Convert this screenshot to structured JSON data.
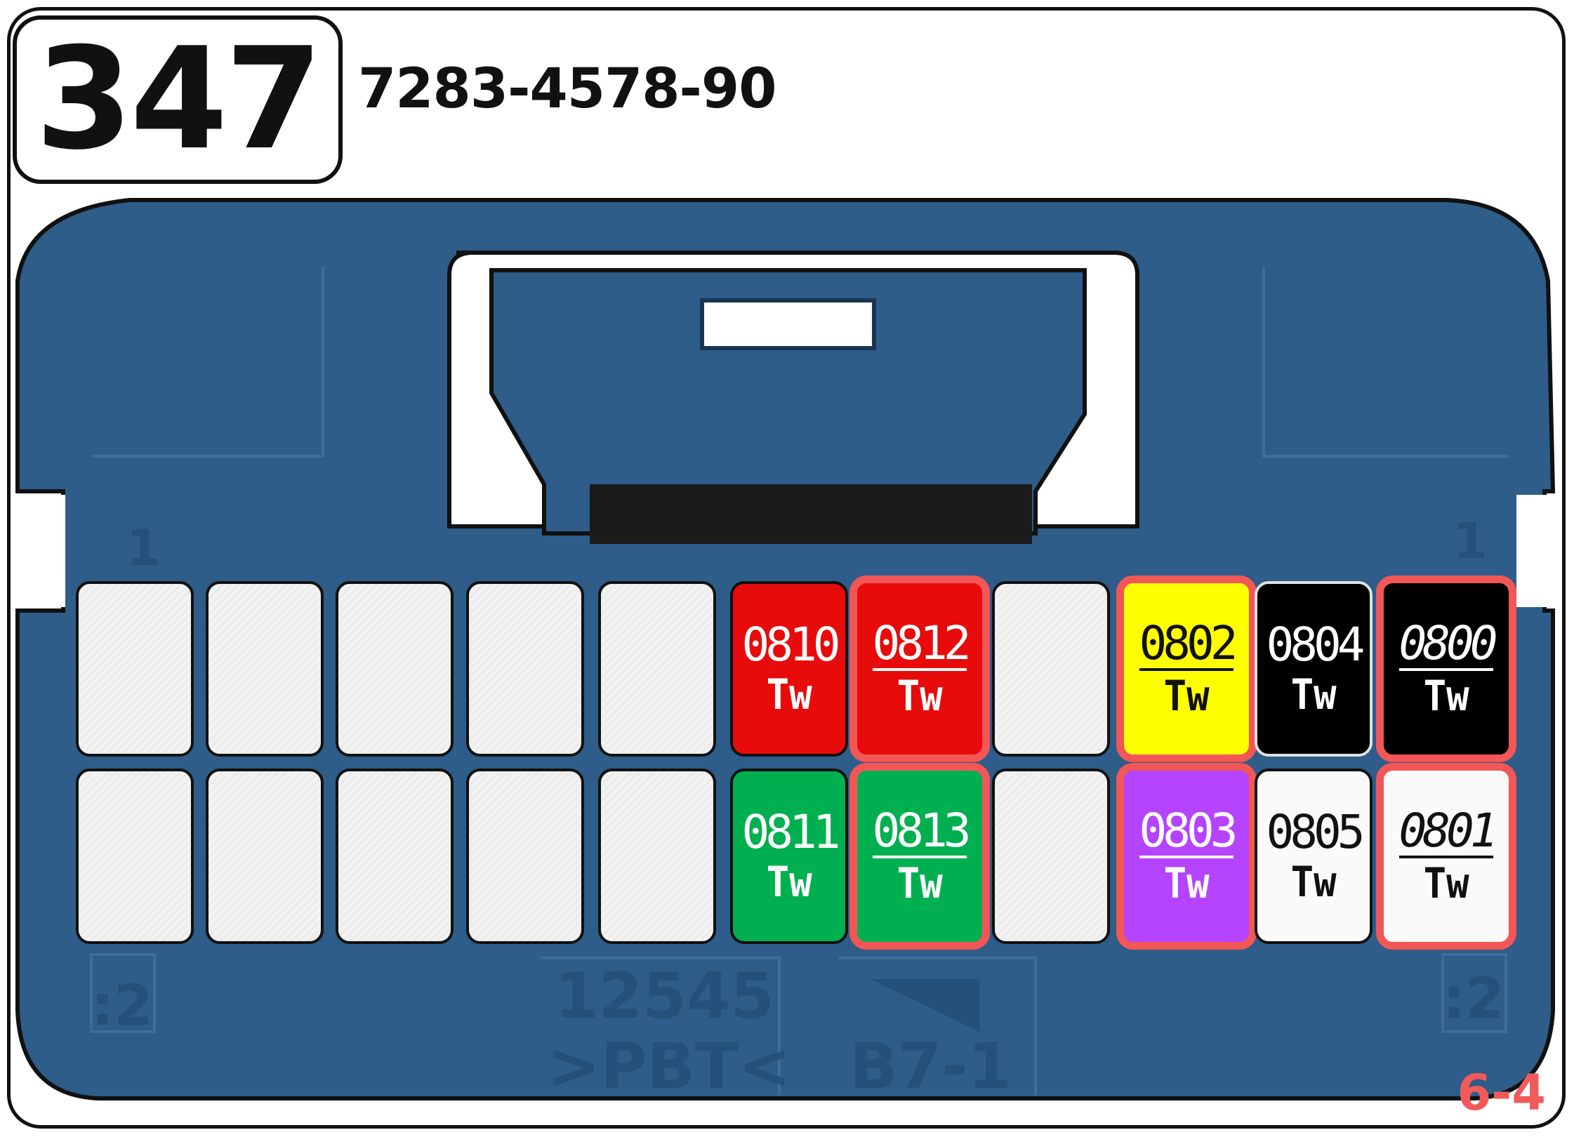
{
  "connector": {
    "id": "347",
    "part_number": "7283-4578-90",
    "page_ref": "6-4",
    "housing_color": "#2d5d88",
    "mold_marks": {
      "top_left": "1",
      "top_right": "1",
      "bottom_left": ":2",
      "bottom_right": ":2",
      "center_code_line1": "12545",
      "center_code_line2": ">PBT<",
      "center_right": "B7-1"
    }
  },
  "cavities": {
    "top_row": [
      {
        "circuit": "",
        "wire": "",
        "fill": "empty"
      },
      {
        "circuit": "",
        "wire": "",
        "fill": "empty"
      },
      {
        "circuit": "",
        "wire": "",
        "fill": "empty"
      },
      {
        "circuit": "",
        "wire": "",
        "fill": "empty"
      },
      {
        "circuit": "",
        "wire": "",
        "fill": "empty"
      },
      {
        "circuit": "0810",
        "wire": "Tw",
        "fill": "#e80b0b",
        "text_color": "#ffffff",
        "highlight": false,
        "underline": false,
        "italic": false
      },
      {
        "circuit": "0812",
        "wire": "Tw",
        "fill": "#e80b0b",
        "text_color": "#ffffff",
        "highlight": true,
        "underline": true,
        "italic": false
      },
      {
        "circuit": "",
        "wire": "",
        "fill": "empty"
      },
      {
        "circuit": "0802",
        "wire": "Tw",
        "fill": "#ffff00",
        "text_color": "#111111",
        "highlight": true,
        "underline": true,
        "italic": false
      },
      {
        "circuit": "0804",
        "wire": "Tw",
        "fill": "#000000",
        "text_color": "#ffffff",
        "highlight": false,
        "underline": false,
        "italic": false
      },
      {
        "circuit": "0800",
        "wire": "Tw",
        "fill": "#000000",
        "text_color": "#ffffff",
        "highlight": true,
        "underline": true,
        "italic": true
      }
    ],
    "bottom_row": [
      {
        "circuit": "",
        "wire": "",
        "fill": "empty"
      },
      {
        "circuit": "",
        "wire": "",
        "fill": "empty"
      },
      {
        "circuit": "",
        "wire": "",
        "fill": "empty"
      },
      {
        "circuit": "",
        "wire": "",
        "fill": "empty"
      },
      {
        "circuit": "",
        "wire": "",
        "fill": "empty"
      },
      {
        "circuit": "0811",
        "wire": "Tw",
        "fill": "#00b050",
        "text_color": "#ffffff",
        "highlight": false,
        "underline": false,
        "italic": false
      },
      {
        "circuit": "0813",
        "wire": "Tw",
        "fill": "#00b050",
        "text_color": "#ffffff",
        "highlight": true,
        "underline": true,
        "italic": false
      },
      {
        "circuit": "",
        "wire": "",
        "fill": "empty"
      },
      {
        "circuit": "0803",
        "wire": "Tw",
        "fill": "#b444ff",
        "text_color": "#ffffff",
        "highlight": true,
        "underline": true,
        "italic": false
      },
      {
        "circuit": "0805",
        "wire": "Tw",
        "fill": "#fafafa",
        "text_color": "#111111",
        "highlight": false,
        "underline": false,
        "italic": false
      },
      {
        "circuit": "0801",
        "wire": "Tw",
        "fill": "#fafafa",
        "text_color": "#111111",
        "highlight": true,
        "underline": true,
        "italic": true
      }
    ]
  }
}
